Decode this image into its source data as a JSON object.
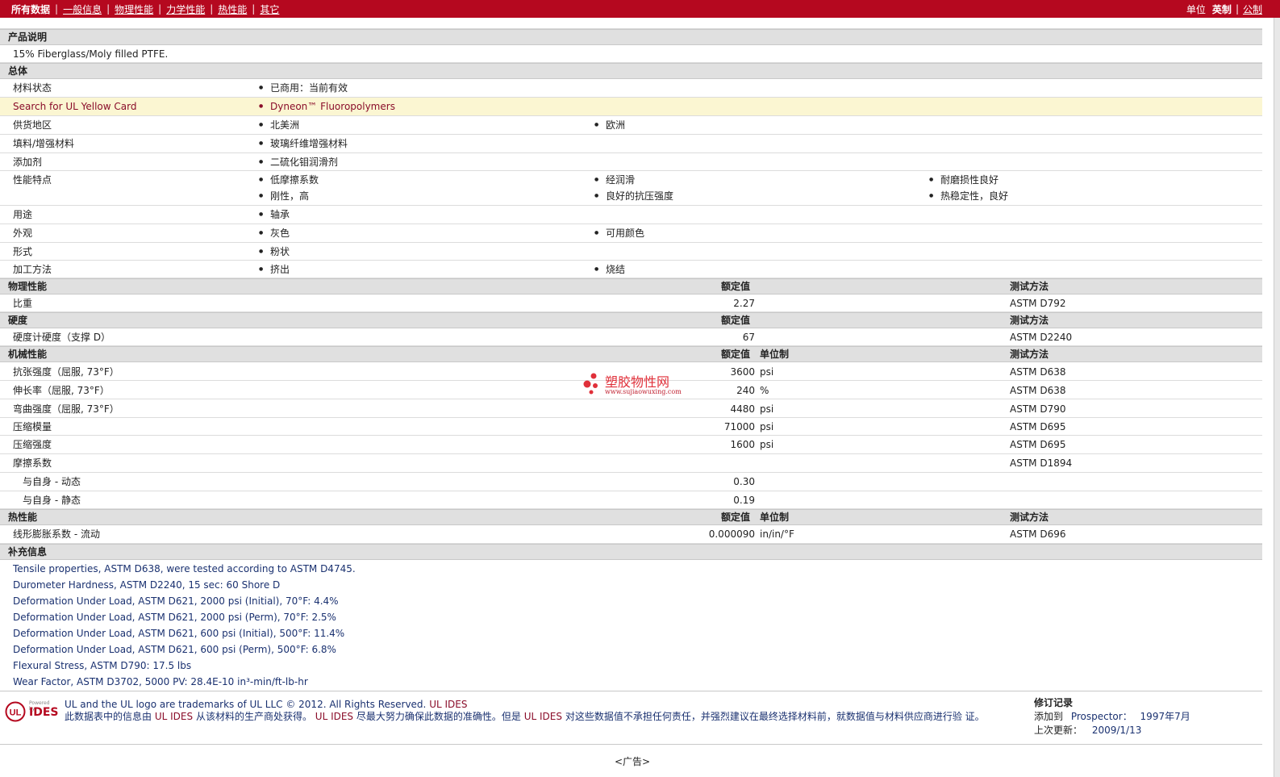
{
  "nav": {
    "current": "所有数据",
    "items": [
      "一般信息",
      "物理性能",
      "力学性能",
      "热性能",
      "其它"
    ]
  },
  "units": {
    "label": "单位",
    "current": "英制",
    "alt": "公制"
  },
  "product": {
    "header": "产品说明",
    "description": "15% Fiberglass/Moly filled PTFE."
  },
  "general": {
    "header": "总体",
    "rows": [
      {
        "label": "材料状态",
        "values": [
          "已商用：当前有效"
        ]
      },
      {
        "label": "Search for UL Yellow Card",
        "values": [
          "Dyneon™ Fluoropolymers"
        ]
      },
      {
        "label": "供货地区",
        "values": [
          "北美洲",
          "欧洲"
        ]
      },
      {
        "label": "填料/增强材料",
        "values": [
          "玻璃纤维增强材料"
        ]
      },
      {
        "label": "添加剂",
        "values": [
          "二硫化钼润滑剂"
        ]
      },
      {
        "label": "性能特点",
        "values": [
          "低摩擦系数",
          "经润滑",
          "耐磨损性良好",
          "刚性，高",
          "良好的抗压强度",
          "热稳定性，良好"
        ]
      },
      {
        "label": "用途",
        "values": [
          "轴承"
        ]
      },
      {
        "label": "外观",
        "values": [
          "灰色",
          "可用颜色"
        ]
      },
      {
        "label": "形式",
        "values": [
          "粉状"
        ]
      },
      {
        "label": "加工方法",
        "values": [
          "挤出",
          "烧结"
        ]
      }
    ]
  },
  "physical": {
    "header": "物理性能",
    "col_value": "额定值",
    "col_method": "测试方法",
    "rows": [
      {
        "label": "比重",
        "value": "2.27",
        "unit": "",
        "method": "ASTM D792"
      }
    ]
  },
  "hardness": {
    "header": "硬度",
    "col_value": "额定值",
    "col_method": "测试方法",
    "rows": [
      {
        "label": "硬度计硬度（支撑 D）",
        "value": "67",
        "unit": "",
        "method": "ASTM D2240"
      }
    ]
  },
  "mechanical": {
    "header": "机械性能",
    "col_value": "额定值",
    "col_unit": "单位制",
    "col_method": "测试方法",
    "rows": [
      {
        "label": "抗张强度（屈服, 73°F）",
        "value": "3600",
        "unit": "psi",
        "method": "ASTM D638"
      },
      {
        "label": "伸长率（屈服, 73°F）",
        "value": "240",
        "unit": "%",
        "method": "ASTM D638"
      },
      {
        "label": "弯曲强度（屈服, 73°F）",
        "value": "4480",
        "unit": "psi",
        "method": "ASTM D790"
      },
      {
        "label": "压缩模量",
        "value": "71000",
        "unit": "psi",
        "method": "ASTM D695"
      },
      {
        "label": "压缩强度",
        "value": "1600",
        "unit": "psi",
        "method": "ASTM D695"
      },
      {
        "label": "摩擦系数",
        "value": "",
        "unit": "",
        "method": "ASTM D1894"
      },
      {
        "label": "与自身 - 动态",
        "value": "0.30",
        "unit": "",
        "method": ""
      },
      {
        "label": "与自身 - 静态",
        "value": "0.19",
        "unit": "",
        "method": ""
      }
    ]
  },
  "thermal": {
    "header": "热性能",
    "col_value": "额定值",
    "col_unit": "单位制",
    "col_method": "测试方法",
    "rows": [
      {
        "label": "线形膨胀系数 - 流动",
        "value": "0.000090",
        "unit": "in/in/°F",
        "method": "ASTM D696"
      }
    ]
  },
  "supplementary": {
    "header": "补充信息",
    "notes": [
      "Tensile properties, ASTM D638, were tested according to ASTM D4745.",
      "Durometer Hardness, ASTM D2240, 15 sec: 60 Shore D",
      "Deformation Under Load, ASTM D621, 2000 psi (Initial), 70°F: 4.4%",
      "Deformation Under Load, ASTM D621, 2000 psi (Perm), 70°F: 2.5%",
      "Deformation Under Load, ASTM D621, 600 psi (Initial), 500°F: 11.4%",
      "Deformation Under Load, ASTM D621, 600 psi (Perm), 500°F: 6.8%",
      "Flexural Stress, ASTM D790: 17.5 lbs",
      "Wear Factor, ASTM D3702, 5000 PV: 28.4E-10 in³-min/ft-lb-hr"
    ]
  },
  "watermark": {
    "title": "塑胶物性网",
    "url": "www.sujiaowuxing.com"
  },
  "footer": {
    "logo_small": "Powered by",
    "logo_text": "IDES",
    "trademark": "UL and the UL logo are trademarks of UL LLC © 2012. All Rights Reserved.",
    "trademark_link": "UL IDES",
    "disclaimer_a": "此数据表中的信息由",
    "disclaimer_b": "从该材料的生产商处获得。",
    "disclaimer_c": "尽最大努力确保此数据的准确性。但是",
    "disclaimer_d": "对这些数据值不承担任何责任，并强烈建议在最终选择材料前，就数据值与材料供应商进行验",
    "disclaimer_e": "证。",
    "ul_ides": "UL IDES",
    "revision_title": "修订记录",
    "added_label": "添加到",
    "added_to": "Prospector：",
    "added_date": "1997年7月",
    "updated_label": "上次更新：",
    "updated_date": "2009/1/13"
  },
  "ad": "<广告>"
}
